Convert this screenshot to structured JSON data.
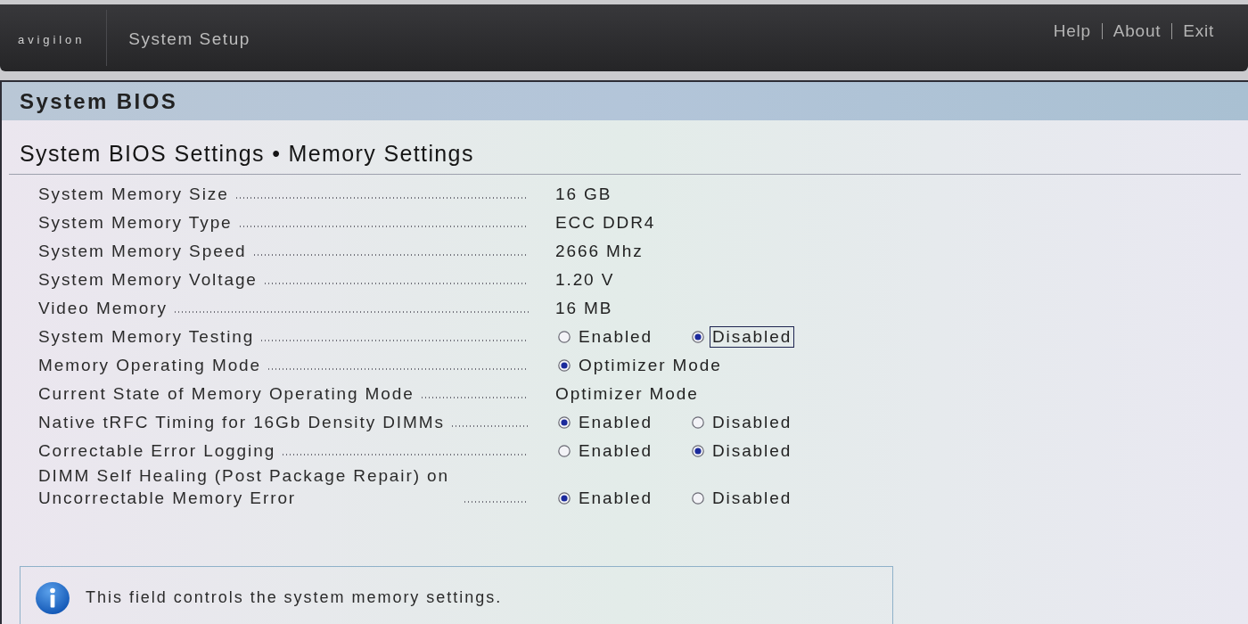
{
  "header": {
    "logo": "avigilon",
    "title": "System Setup",
    "links": [
      "Help",
      "About",
      "Exit"
    ]
  },
  "panel": {
    "title": "System BIOS",
    "subtitle": "System BIOS Settings • Memory Settings"
  },
  "settings": [
    {
      "label": "System Memory Size",
      "kind": "text",
      "value": "16 GB"
    },
    {
      "label": "System Memory Type",
      "kind": "text",
      "value": "ECC DDR4"
    },
    {
      "label": "System Memory Speed",
      "kind": "text",
      "value": "2666 Mhz"
    },
    {
      "label": "System Memory Voltage",
      "kind": "text",
      "value": "1.20 V"
    },
    {
      "label": "Video Memory",
      "kind": "text",
      "value": "16 MB"
    },
    {
      "label": "System Memory Testing",
      "kind": "radio",
      "options": [
        {
          "label": "Enabled",
          "selected": false,
          "focused": false
        },
        {
          "label": "Disabled",
          "selected": true,
          "focused": true
        }
      ]
    },
    {
      "label": "Memory Operating Mode",
      "kind": "radio",
      "options": [
        {
          "label": "Optimizer Mode",
          "selected": true,
          "focused": false
        }
      ]
    },
    {
      "label": "Current State of Memory Operating Mode",
      "kind": "text",
      "value": "Optimizer Mode"
    },
    {
      "label": "Native tRFC Timing for 16Gb Density DIMMs",
      "kind": "radio",
      "options": [
        {
          "label": "Enabled",
          "selected": true,
          "focused": false
        },
        {
          "label": "Disabled",
          "selected": false,
          "focused": false
        }
      ]
    },
    {
      "label": "Correctable Error Logging",
      "kind": "radio",
      "options": [
        {
          "label": "Enabled",
          "selected": false,
          "focused": false
        },
        {
          "label": "Disabled",
          "selected": true,
          "focused": false
        }
      ]
    },
    {
      "label": "DIMM Self Healing (Post Package Repair) on Uncorrectable Memory Error",
      "kind": "radio",
      "options": [
        {
          "label": "Enabled",
          "selected": true,
          "focused": false
        },
        {
          "label": "Disabled",
          "selected": false,
          "focused": false
        }
      ]
    }
  ],
  "help": {
    "text": "This field controls the system memory settings."
  }
}
